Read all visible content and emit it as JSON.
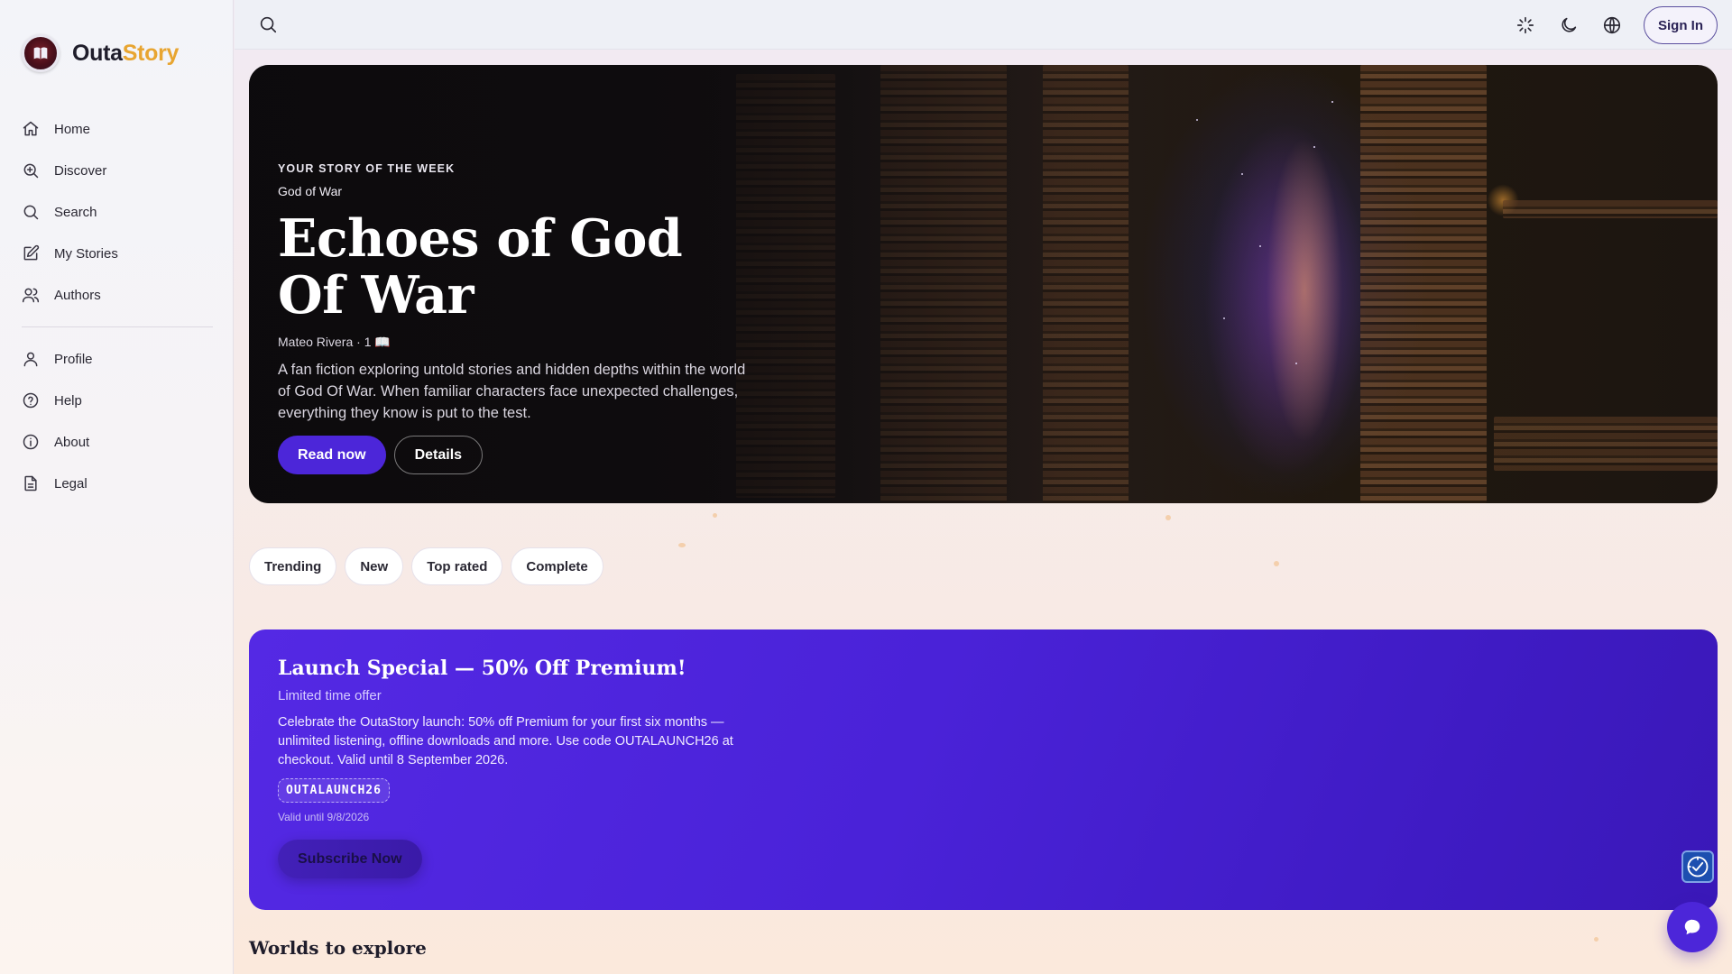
{
  "brand": {
    "name_part1": "Outa",
    "name_part2": "Story",
    "logo_icon": "book-logo-icon"
  },
  "sidebar": {
    "items": [
      {
        "label": "Home",
        "icon": "home-icon"
      },
      {
        "label": "Discover",
        "icon": "discover-icon"
      },
      {
        "label": "Search",
        "icon": "search-icon"
      },
      {
        "label": "My Stories",
        "icon": "edit-icon"
      },
      {
        "label": "Authors",
        "icon": "users-icon"
      }
    ],
    "secondary_items": [
      {
        "label": "Profile",
        "icon": "user-icon"
      },
      {
        "label": "Help",
        "icon": "help-icon"
      },
      {
        "label": "About",
        "icon": "info-icon"
      },
      {
        "label": "Legal",
        "icon": "document-icon"
      }
    ]
  },
  "topbar": {
    "search_icon": "search-icon",
    "icons": [
      "sparkle-icon",
      "moon-icon",
      "globe-icon"
    ],
    "signin_label": "Sign In"
  },
  "hero": {
    "kicker": "YOUR STORY OF THE WEEK",
    "genre": "God of War",
    "title": "Echoes of God Of War",
    "meta": "Mateo Rivera · 1 📖",
    "description": "A fan fiction exploring untold stories and hidden depths within the world of God Of War. When familiar characters face unexpected challenges, everything they know is put to the test.",
    "primary_button": "Read now",
    "secondary_button": "Details"
  },
  "filters": [
    "Trending",
    "New",
    "Top rated",
    "Complete"
  ],
  "promo": {
    "title": "Launch Special — 50% Off Premium!",
    "subtitle": "Limited time offer",
    "body": "Celebrate the OutaStory launch: 50% off Premium for your first six months — unlimited listening, offline downloads and more. Use code OUTALAUNCH26 at checkout. Valid until 8 September 2026.",
    "code": "OUTALAUNCH26",
    "valid": "Valid until 9/8/2026",
    "button": "Subscribe Now"
  },
  "section": {
    "title": "Worlds to explore"
  },
  "colors": {
    "accent": "#4c26d9",
    "brand_highlight": "#e8a531",
    "promo_bg": "#4a22d8"
  }
}
